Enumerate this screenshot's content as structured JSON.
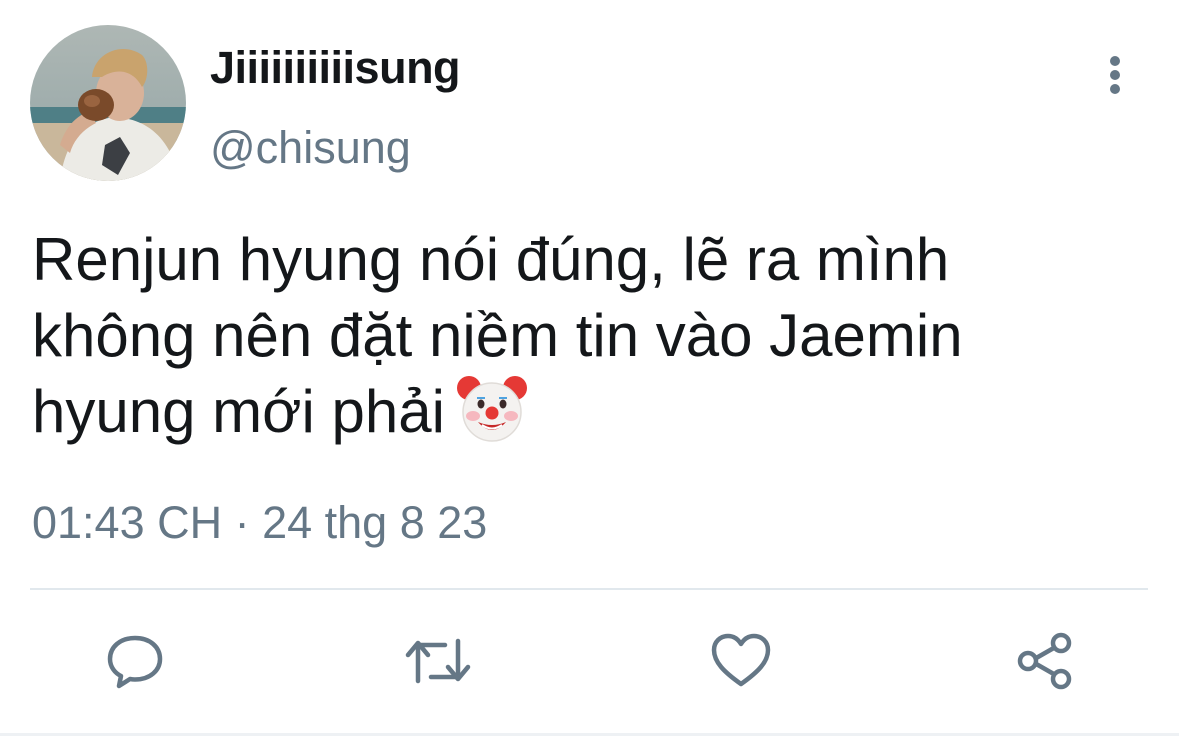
{
  "tweet": {
    "display_name": "Jiiiiiiiiiisung",
    "handle": "@chisung",
    "text": "Renjun hyung nói đúng, lẽ ra mình\nkhông nên đặt niềm tin vào Jaemin\nhyung mới phải",
    "emoji": "clown-face",
    "timestamp": "01:43 CH · 24 thg 8 23"
  },
  "actions": [
    {
      "name": "reply",
      "icon": "speech-bubble-icon"
    },
    {
      "name": "retweet",
      "icon": "retweet-arrows-icon"
    },
    {
      "name": "like",
      "icon": "heart-icon"
    },
    {
      "name": "share",
      "icon": "share-nodes-icon"
    }
  ],
  "colors": {
    "text": "#14171a",
    "secondary": "#657786",
    "divider": "#e1e8ed"
  }
}
